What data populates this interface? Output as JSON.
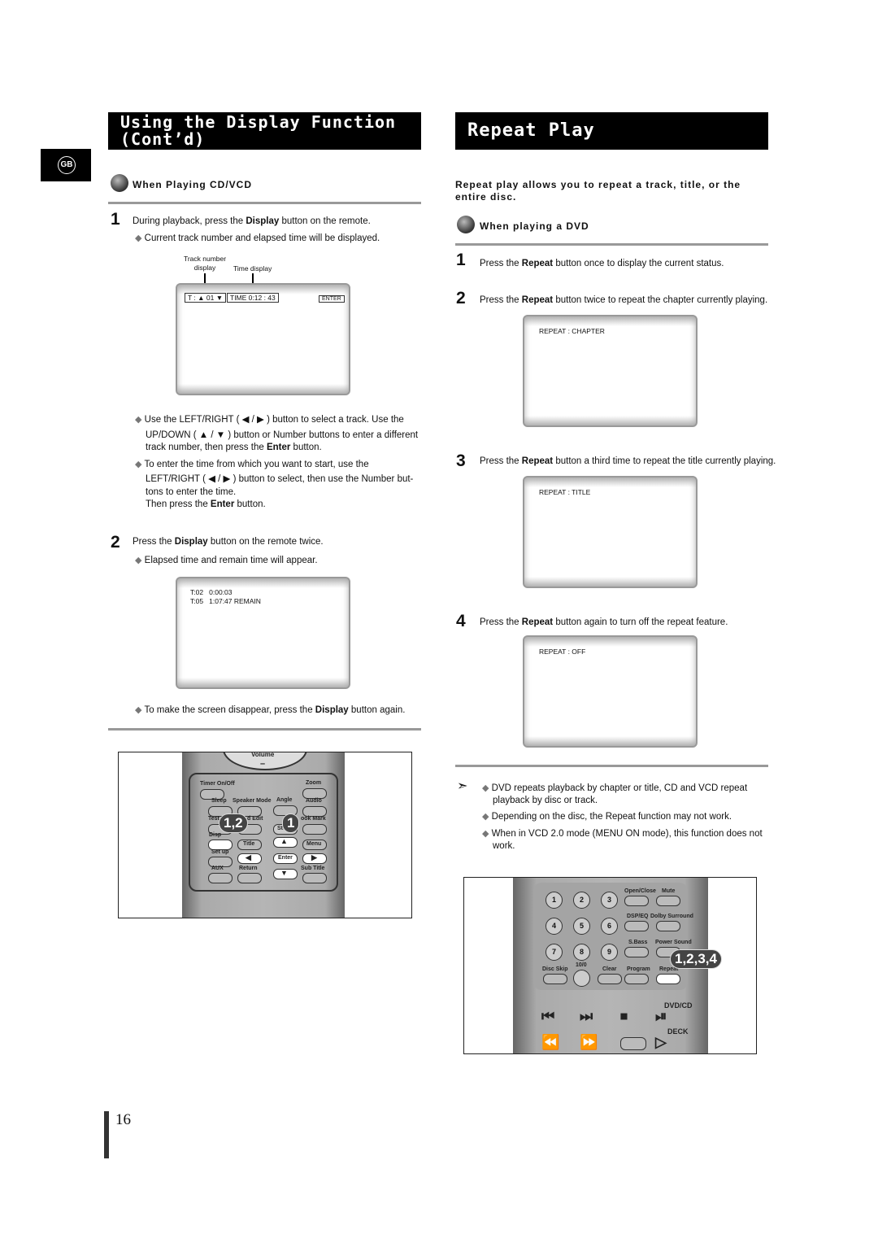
{
  "badge": "GB",
  "left": {
    "title": "Using the Display Function (Cont’d)",
    "subtitle": "When Playing CD/VCD",
    "step1": {
      "num": "1",
      "pre": "During playback, press the ",
      "bold": "Display",
      "post": " button on the remote.",
      "bullet": "Current track number and elapsed time will be displayed."
    },
    "labels": {
      "track": "Track number display",
      "time": "Time display"
    },
    "screen1": {
      "track": "T : ▲ 01 ▼",
      "time": "TIME 0:12 : 43",
      "enter": "ENTER"
    },
    "bullets": [
      {
        "l1": "Use the LEFT/RIGHT ( ◀ / ▶ ) button to select a track. Use the",
        "l2": "UP/DOWN ( ▲ / ▼ ) button or Number buttons to enter a different",
        "l3pre": "track number, then press the ",
        "l3bold": "Enter",
        "l3post": " button."
      },
      {
        "l1": "To enter the time from which you want to start, use the",
        "l2": "LEFT/RIGHT ( ◀ / ▶ ) button to select, then use the Number but-",
        "l3": "tons to enter the time.",
        "l4pre": "Then press the ",
        "l4bold": "Enter",
        "l4post": " button."
      }
    ],
    "step2": {
      "num": "2",
      "pre": "Press the ",
      "bold": "Display",
      "post": " button on the remote twice.",
      "bullet": "Elapsed time and remain time will appear."
    },
    "screen2": {
      "line1": "T:02   0:00:03",
      "line2": "T:05   1:07:47 REMAIN"
    },
    "final": {
      "pre": "To make the screen disappear, press the ",
      "bold": "Display",
      "post": " button again."
    },
    "remote": {
      "top": "Volume",
      "minus": "–",
      "buttons": [
        "Timer On/Off",
        "Zoom",
        "Sleep",
        "Speaker Mode",
        "Angle",
        "Audio",
        "Test T",
        "d Edit",
        "Step",
        "ook Mark",
        "Disp",
        "Title",
        "Menu",
        "Set up",
        "Enter",
        "AUX",
        "Return",
        "Sub Title"
      ],
      "callouts": [
        "1,2",
        "1"
      ]
    }
  },
  "right": {
    "title": "Repeat Play",
    "intro": "Repeat play allows you to repeat a track, title, or the entire disc.",
    "subtitle": "When playing a DVD",
    "steps": [
      {
        "num": "1",
        "pre": "Press the ",
        "bold": "Repeat",
        "post": " button once to display the current status."
      },
      {
        "num": "2",
        "pre": "Press the ",
        "bold": "Repeat",
        "post": " button twice to repeat the chapter currently playing.",
        "screen": "REPEAT : CHAPTER"
      },
      {
        "num": "3",
        "pre": "Press the ",
        "bold": "Repeat",
        "post": " button a third time to repeat the title currently playing.",
        "screen": "REPEAT : TITLE"
      },
      {
        "num": "4",
        "pre": "Press the ",
        "bold": "Repeat",
        "post": " button again to turn off the repeat feature.",
        "screen": "REPEAT : OFF"
      }
    ],
    "notes": [
      {
        "l1": "DVD repeats playback by chapter or title, CD and VCD repeat",
        "l2": "playback by disc or track."
      },
      {
        "l1": "Depending on the disc, the Repeat function may not work."
      },
      {
        "l1": "When in VCD 2.0 mode (MENU ON mode), this function does not",
        "l2": "work."
      }
    ],
    "remote": {
      "digits": [
        "1",
        "2",
        "3",
        "4",
        "5",
        "6",
        "7",
        "8",
        "9"
      ],
      "labels": [
        "Open/Close",
        "Mute",
        "DSP/EQ",
        "Dolby Surround",
        "S.Bass",
        "Power Sound",
        "Disc Skip",
        "10/0",
        "Clear",
        "Program",
        "Repeat"
      ],
      "dvdcd": "DVD/CD",
      "deck": "DECK",
      "callout": "1,2,3,4"
    }
  },
  "page_number": "16"
}
